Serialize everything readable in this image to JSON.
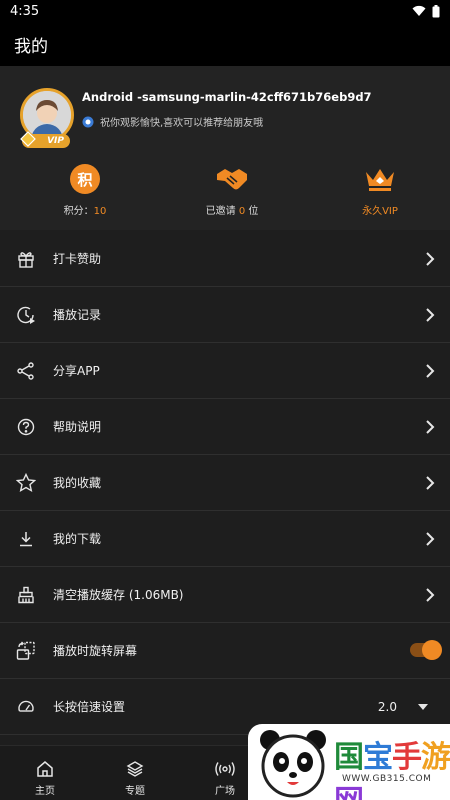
{
  "status": {
    "time": "4:35"
  },
  "header": {
    "title": "我的"
  },
  "profile": {
    "username": "Android -samsung-marlin-42cff671b76eb9d7",
    "signature": "祝你观影愉快,喜欢可以推荐给朋友哦",
    "vip_badge": "VIP",
    "stats": {
      "points_icon": "积",
      "points_label": "积分：",
      "points_value": "10",
      "invited_prefix": "已邀请",
      "invited_value": "0",
      "invited_suffix": "位",
      "vip_label": "永久VIP"
    }
  },
  "menu": {
    "items": [
      {
        "label": "打卡赞助",
        "icon": "gift-icon"
      },
      {
        "label": "播放记录",
        "icon": "history-icon"
      },
      {
        "label": "分享APP",
        "icon": "share-icon"
      },
      {
        "label": "帮助说明",
        "icon": "help-icon"
      },
      {
        "label": "我的收藏",
        "icon": "star-icon"
      },
      {
        "label": "我的下载",
        "icon": "download-icon"
      },
      {
        "label": "清空播放缓存 (1.06MB)",
        "icon": "broom-icon"
      },
      {
        "label": "播放时旋转屏幕",
        "icon": "rotate-screen-icon",
        "toggle": true
      },
      {
        "label": "长按倍速设置",
        "icon": "speed-icon",
        "value": "2.0"
      }
    ]
  },
  "bottom_nav": {
    "tabs": [
      {
        "label": "主页",
        "icon": "home-icon"
      },
      {
        "label": "专题",
        "icon": "layers-icon"
      },
      {
        "label": "广场",
        "icon": "broadcast-icon"
      }
    ]
  },
  "watermark": {
    "text": "国宝手游网",
    "sub": "WWW.GB315.COM"
  },
  "colors": {
    "accent": "#f08a24",
    "background": "#1e1e1e",
    "bar": "#000000",
    "profile_bg": "#232323"
  }
}
